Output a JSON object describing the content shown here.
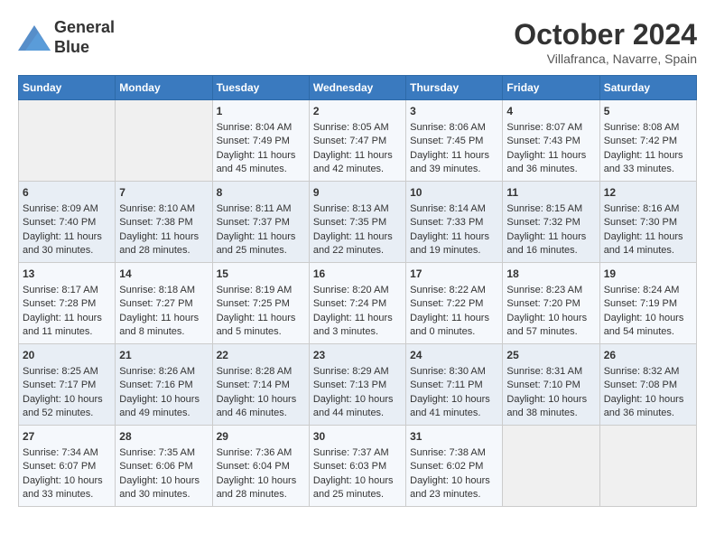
{
  "header": {
    "logo_line1": "General",
    "logo_line2": "Blue",
    "month": "October 2024",
    "location": "Villafranca, Navarre, Spain"
  },
  "weekdays": [
    "Sunday",
    "Monday",
    "Tuesday",
    "Wednesday",
    "Thursday",
    "Friday",
    "Saturday"
  ],
  "weeks": [
    [
      {
        "day": "",
        "content": ""
      },
      {
        "day": "",
        "content": ""
      },
      {
        "day": "1",
        "content": "Sunrise: 8:04 AM\nSunset: 7:49 PM\nDaylight: 11 hours and 45 minutes."
      },
      {
        "day": "2",
        "content": "Sunrise: 8:05 AM\nSunset: 7:47 PM\nDaylight: 11 hours and 42 minutes."
      },
      {
        "day": "3",
        "content": "Sunrise: 8:06 AM\nSunset: 7:45 PM\nDaylight: 11 hours and 39 minutes."
      },
      {
        "day": "4",
        "content": "Sunrise: 8:07 AM\nSunset: 7:43 PM\nDaylight: 11 hours and 36 minutes."
      },
      {
        "day": "5",
        "content": "Sunrise: 8:08 AM\nSunset: 7:42 PM\nDaylight: 11 hours and 33 minutes."
      }
    ],
    [
      {
        "day": "6",
        "content": "Sunrise: 8:09 AM\nSunset: 7:40 PM\nDaylight: 11 hours and 30 minutes."
      },
      {
        "day": "7",
        "content": "Sunrise: 8:10 AM\nSunset: 7:38 PM\nDaylight: 11 hours and 28 minutes."
      },
      {
        "day": "8",
        "content": "Sunrise: 8:11 AM\nSunset: 7:37 PM\nDaylight: 11 hours and 25 minutes."
      },
      {
        "day": "9",
        "content": "Sunrise: 8:13 AM\nSunset: 7:35 PM\nDaylight: 11 hours and 22 minutes."
      },
      {
        "day": "10",
        "content": "Sunrise: 8:14 AM\nSunset: 7:33 PM\nDaylight: 11 hours and 19 minutes."
      },
      {
        "day": "11",
        "content": "Sunrise: 8:15 AM\nSunset: 7:32 PM\nDaylight: 11 hours and 16 minutes."
      },
      {
        "day": "12",
        "content": "Sunrise: 8:16 AM\nSunset: 7:30 PM\nDaylight: 11 hours and 14 minutes."
      }
    ],
    [
      {
        "day": "13",
        "content": "Sunrise: 8:17 AM\nSunset: 7:28 PM\nDaylight: 11 hours and 11 minutes."
      },
      {
        "day": "14",
        "content": "Sunrise: 8:18 AM\nSunset: 7:27 PM\nDaylight: 11 hours and 8 minutes."
      },
      {
        "day": "15",
        "content": "Sunrise: 8:19 AM\nSunset: 7:25 PM\nDaylight: 11 hours and 5 minutes."
      },
      {
        "day": "16",
        "content": "Sunrise: 8:20 AM\nSunset: 7:24 PM\nDaylight: 11 hours and 3 minutes."
      },
      {
        "day": "17",
        "content": "Sunrise: 8:22 AM\nSunset: 7:22 PM\nDaylight: 11 hours and 0 minutes."
      },
      {
        "day": "18",
        "content": "Sunrise: 8:23 AM\nSunset: 7:20 PM\nDaylight: 10 hours and 57 minutes."
      },
      {
        "day": "19",
        "content": "Sunrise: 8:24 AM\nSunset: 7:19 PM\nDaylight: 10 hours and 54 minutes."
      }
    ],
    [
      {
        "day": "20",
        "content": "Sunrise: 8:25 AM\nSunset: 7:17 PM\nDaylight: 10 hours and 52 minutes."
      },
      {
        "day": "21",
        "content": "Sunrise: 8:26 AM\nSunset: 7:16 PM\nDaylight: 10 hours and 49 minutes."
      },
      {
        "day": "22",
        "content": "Sunrise: 8:28 AM\nSunset: 7:14 PM\nDaylight: 10 hours and 46 minutes."
      },
      {
        "day": "23",
        "content": "Sunrise: 8:29 AM\nSunset: 7:13 PM\nDaylight: 10 hours and 44 minutes."
      },
      {
        "day": "24",
        "content": "Sunrise: 8:30 AM\nSunset: 7:11 PM\nDaylight: 10 hours and 41 minutes."
      },
      {
        "day": "25",
        "content": "Sunrise: 8:31 AM\nSunset: 7:10 PM\nDaylight: 10 hours and 38 minutes."
      },
      {
        "day": "26",
        "content": "Sunrise: 8:32 AM\nSunset: 7:08 PM\nDaylight: 10 hours and 36 minutes."
      }
    ],
    [
      {
        "day": "27",
        "content": "Sunrise: 7:34 AM\nSunset: 6:07 PM\nDaylight: 10 hours and 33 minutes."
      },
      {
        "day": "28",
        "content": "Sunrise: 7:35 AM\nSunset: 6:06 PM\nDaylight: 10 hours and 30 minutes."
      },
      {
        "day": "29",
        "content": "Sunrise: 7:36 AM\nSunset: 6:04 PM\nDaylight: 10 hours and 28 minutes."
      },
      {
        "day": "30",
        "content": "Sunrise: 7:37 AM\nSunset: 6:03 PM\nDaylight: 10 hours and 25 minutes."
      },
      {
        "day": "31",
        "content": "Sunrise: 7:38 AM\nSunset: 6:02 PM\nDaylight: 10 hours and 23 minutes."
      },
      {
        "day": "",
        "content": ""
      },
      {
        "day": "",
        "content": ""
      }
    ]
  ]
}
